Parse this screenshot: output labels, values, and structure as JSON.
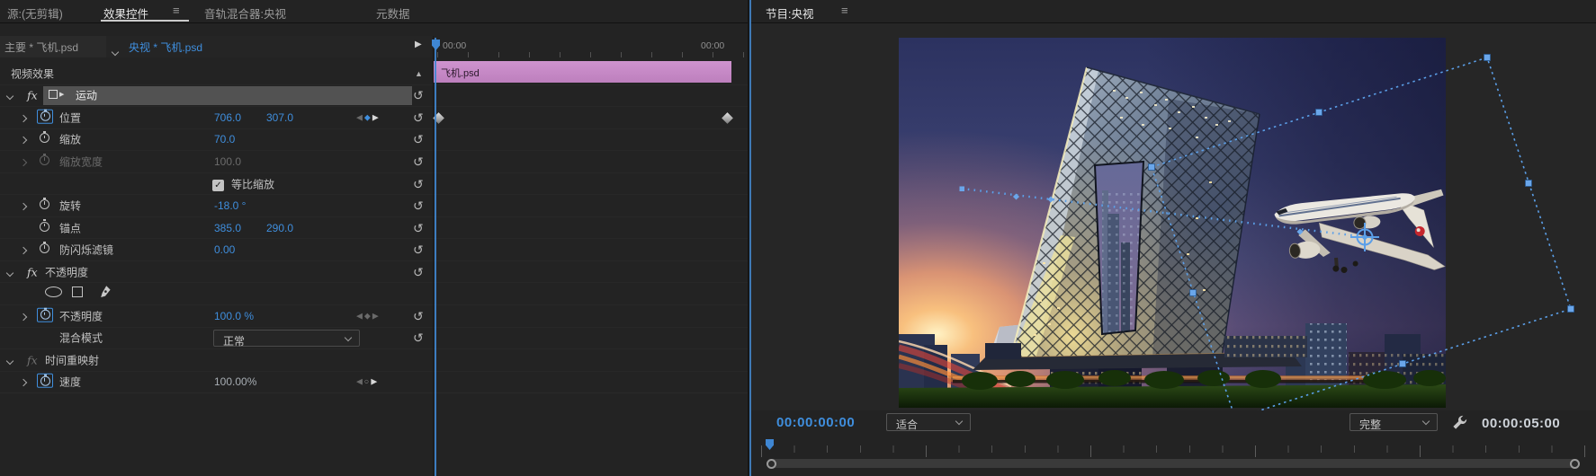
{
  "icons": {
    "menu": "≡",
    "collapse": "▲",
    "play": "▶",
    "nav_left": "◀",
    "nav_right": "▶",
    "keyframe_diamond": "◆",
    "keyframe_circle": "○",
    "reset": "↺",
    "check": "✓",
    "fx": "fx"
  },
  "left_panel": {
    "tabs": [
      {
        "label": "源:(无剪辑)"
      },
      {
        "label": "效果控件"
      },
      {
        "label": "音轨混合器:央视"
      },
      {
        "label": "元数据"
      }
    ],
    "clip_selector": {
      "master": "主要 * 飞机.psd",
      "clip": "央视 * 飞机.psd"
    },
    "effects": {
      "header": "视频效果",
      "motion": {
        "label": "运动"
      },
      "position": {
        "label": "位置",
        "x": "706.0",
        "y": "307.0"
      },
      "scale": {
        "label": "缩放",
        "value": "70.0"
      },
      "scale_width": {
        "label": "缩放宽度",
        "value": "100.0"
      },
      "uniform_scale": {
        "label": "等比缩放"
      },
      "rotation": {
        "label": "旋转",
        "value": "-18.0 °"
      },
      "anchor_point": {
        "label": "锚点",
        "x": "385.0",
        "y": "290.0"
      },
      "antiflicker": {
        "label": "防闪烁滤镜",
        "value": "0.00"
      },
      "opacity_section": {
        "label": "不透明度"
      },
      "opacity": {
        "label": "不透明度",
        "value": "100.0 %"
      },
      "blend_mode": {
        "label": "混合模式",
        "value": "正常"
      },
      "time_remap_section": {
        "label": "时间重映射"
      },
      "speed": {
        "label": "速度",
        "value": "100.00%"
      }
    },
    "timeline": {
      "start_label": "00:00",
      "end_label": "00:00",
      "clip_name": "飞机.psd"
    }
  },
  "program": {
    "tab": "节目:央视",
    "current_timecode": "00:00:00:00",
    "zoom_select": "适合",
    "quality_select": "完整",
    "duration": "00:00:05:00"
  }
}
